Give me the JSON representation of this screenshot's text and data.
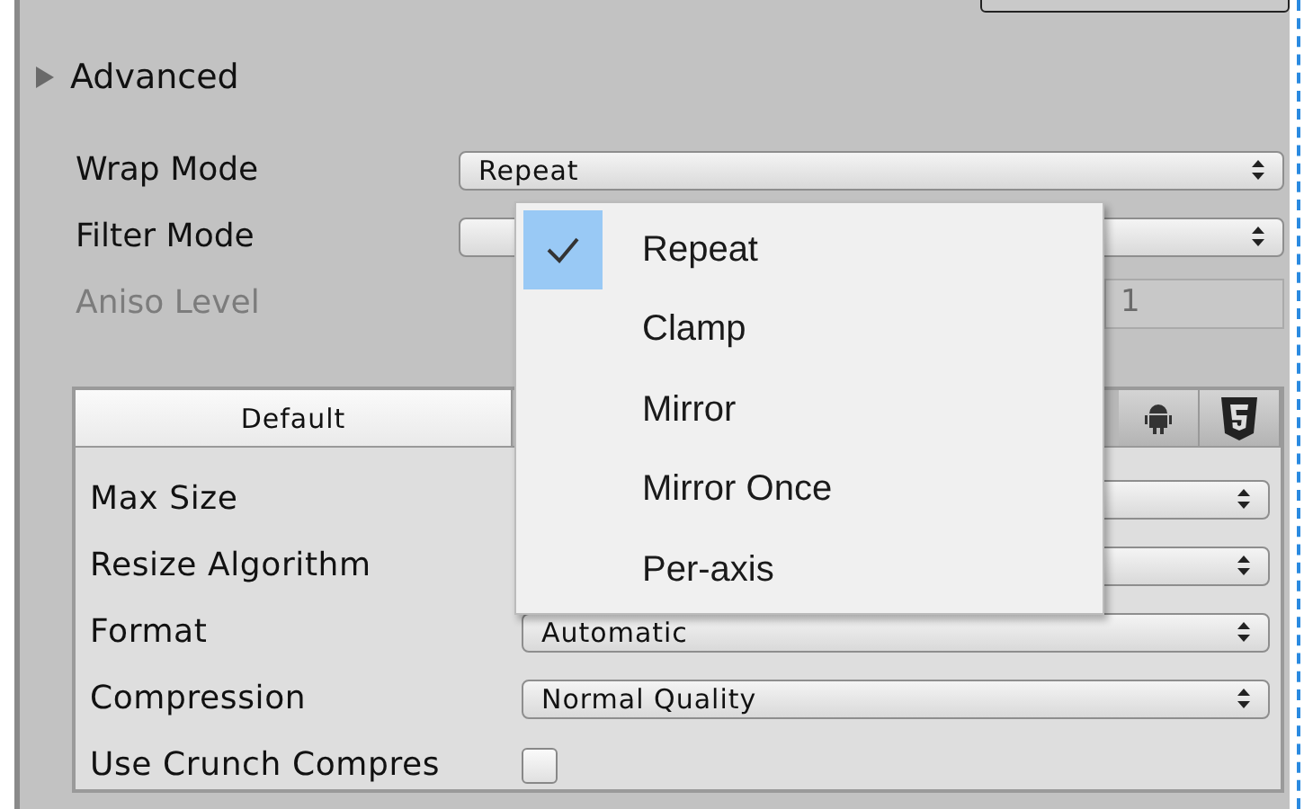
{
  "advanced": {
    "label": "Advanced",
    "expanded": false
  },
  "fields": [
    {
      "kind": "dropdown",
      "label": "Wrap Mode",
      "value": "Repeat",
      "disabled": false
    },
    {
      "kind": "dropdown",
      "label": "Filter Mode",
      "disabled": false
    },
    {
      "kind": "number",
      "label": "Aniso Level",
      "value": "1",
      "disabled": true
    }
  ],
  "platform_tabs": [
    {
      "kind": "text",
      "label": "Default",
      "selected": true
    },
    {
      "kind": "android",
      "selected": false
    },
    {
      "kind": "html5",
      "selected": false
    }
  ],
  "settings": [
    {
      "kind": "dropdown",
      "label": "Max Size"
    },
    {
      "kind": "dropdown",
      "label": "Resize Algorithm"
    },
    {
      "kind": "dropdown",
      "label": "Format",
      "value": "Automatic"
    },
    {
      "kind": "dropdown",
      "label": "Compression",
      "value": "Normal Quality"
    },
    {
      "kind": "checkbox",
      "label": "Use Crunch Compres",
      "checked": false
    }
  ],
  "menu": {
    "items": [
      {
        "label": "Repeat",
        "selected": true
      },
      {
        "label": "Clamp",
        "selected": false
      },
      {
        "label": "Mirror",
        "selected": false
      },
      {
        "label": "Mirror Once",
        "selected": false
      },
      {
        "label": "Per-axis",
        "selected": false
      }
    ]
  }
}
